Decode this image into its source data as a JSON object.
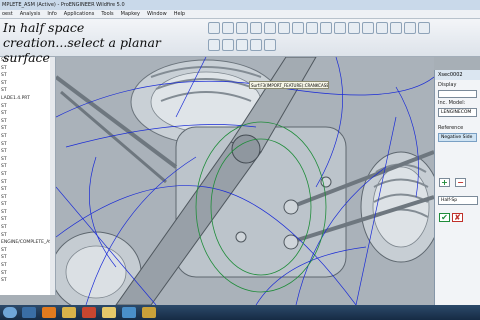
{
  "window": {
    "title": "MPLETE_ASM (Active) - ProENGINEER Wildfire 5.0"
  },
  "menu": [
    "oest",
    "Analysis",
    "Info",
    "Applications",
    "Tools",
    "Mapkey",
    "Window",
    "Help"
  ],
  "caption": {
    "line1": "In half space",
    "line2": "creation...select a planar",
    "line3": "surface"
  },
  "tree": {
    "items": [
      "ST",
      "ST",
      "ST",
      "ST",
      "ST",
      "LADE1.4.PRT",
      "ST",
      "ST",
      "ST",
      "ST",
      "ST",
      "ST",
      "ST",
      "ST",
      "ST",
      "ST",
      "ST",
      "ST",
      "ST",
      "ST",
      "ST",
      "ST",
      "ST",
      "ST",
      "ENGINE/COMPLETE_ASM.0",
      "ST",
      "ST",
      "ST",
      "ST",
      "ST"
    ]
  },
  "callout": {
    "text": "Surf:F3(IMPORT_FEATURE):CRANKCASE_1"
  },
  "dialog": {
    "title": "Xsec0002",
    "display_label": "Display",
    "display_value": "",
    "section_label": "Inc. Model:",
    "field_value": "LENGINECOM",
    "reference_label": "Reference",
    "list_item": "Negative Side",
    "halfspace_label": "Half-Sp",
    "add_label": "+",
    "remove_label": "−",
    "ok_label": "✔",
    "cancel_label": "✘"
  },
  "taskbar": {
    "time": ""
  },
  "colors": {
    "curves": "#1a2bd6",
    "accent": "#1f8c3a"
  }
}
